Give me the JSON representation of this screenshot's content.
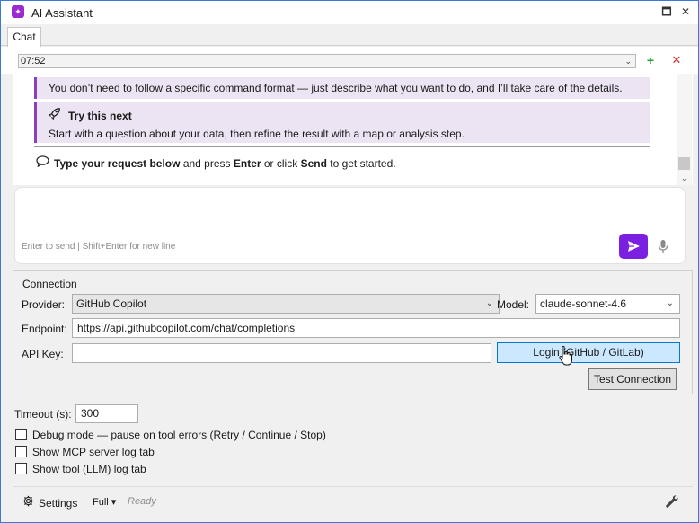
{
  "window": {
    "title": "AI Assistant",
    "minimize": "🗖",
    "close": "✕"
  },
  "tabs": [
    {
      "label": "Chat"
    }
  ],
  "session": {
    "value": "07:52",
    "add_icon": "+",
    "delete_icon": "✕"
  },
  "chat": {
    "note": "You don’t need to follow a specific command format — just describe what you want to do, and I’ll take care of the details.",
    "tip_title": "Try this next",
    "tip_body": "Start with a question about your data, then refine the result with a map or analysis step.",
    "cta_bold1": "Type your request below",
    "cta_text1": " and press ",
    "cta_bold2": "Enter",
    "cta_text2": " or click ",
    "cta_bold3": "Send",
    "cta_text3": " to get started."
  },
  "input": {
    "hint": "Enter to send  |  Shift+Enter for new line",
    "accent": "#7b1fe0"
  },
  "connection": {
    "group_label": "Connection",
    "provider_label": "Provider:",
    "provider_value": "GitHub Copilot",
    "model_label": "Model:",
    "model_value": "claude-sonnet-4.6",
    "endpoint_label": "Endpoint:",
    "endpoint_value": "https://api.githubcopilot.com/chat/completions",
    "apikey_label": "API Key:",
    "apikey_value": "",
    "login_label": "Login (GitHub / GitLab)",
    "test_label": "Test Connection"
  },
  "options": {
    "timeout_label": "Timeout (s):",
    "timeout_value": "300",
    "checks": [
      {
        "label": "Debug mode — pause on tool errors (Retry / Continue / Stop)",
        "checked": false
      },
      {
        "label": "Show MCP server log tab",
        "checked": false
      },
      {
        "label": "Show tool (LLM) log tab",
        "checked": false
      }
    ]
  },
  "status": {
    "settings_label": "Settings",
    "mode_label": "Full ▾",
    "state": "Ready"
  }
}
